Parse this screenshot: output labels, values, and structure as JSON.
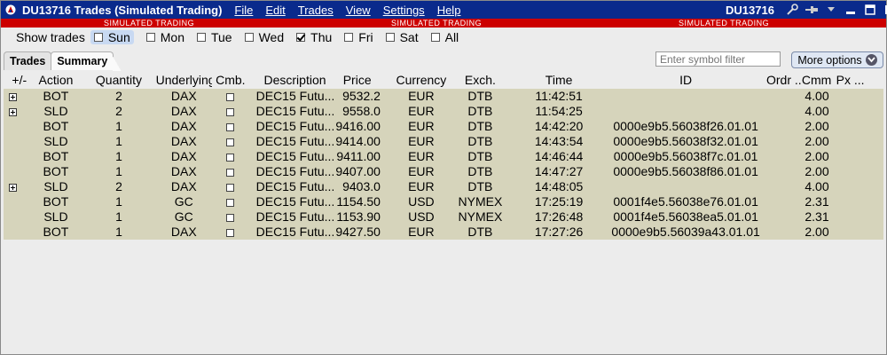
{
  "window": {
    "title": "DU13716 Trades (Simulated Trading)",
    "account": "DU13716",
    "menu": [
      "File",
      "Edit",
      "Trades",
      "View",
      "Settings",
      "Help"
    ],
    "banner_text": "SIMULATED TRADING"
  },
  "show_trades": {
    "label": "Show trades",
    "days": [
      {
        "label": "Sun",
        "checked": false,
        "active": true
      },
      {
        "label": "Mon",
        "checked": false
      },
      {
        "label": "Tue",
        "checked": false
      },
      {
        "label": "Wed",
        "checked": false
      },
      {
        "label": "Thu",
        "checked": true
      },
      {
        "label": "Fri",
        "checked": false
      },
      {
        "label": "Sat",
        "checked": false
      },
      {
        "label": "All",
        "checked": false
      }
    ]
  },
  "tabs": [
    {
      "label": "Trades",
      "active": false
    },
    {
      "label": "Summary",
      "active": true
    }
  ],
  "symbol_filter": {
    "placeholder": "Enter symbol filter",
    "value": ""
  },
  "more_options_label": "More options",
  "columns": [
    "+/-",
    "Action",
    "Quantity",
    "Underlying",
    "Cmb.",
    "Description",
    "Price",
    "Currency",
    "Exch.",
    "Time",
    "ID",
    "Ordr ...",
    "Cmm",
    "Px ..."
  ],
  "rows": [
    {
      "expand": true,
      "action": "BOT",
      "quantity": "2",
      "underlying": "DAX",
      "description": "DEC15 Futu...",
      "price": "9532.2",
      "currency": "EUR",
      "exchange": "DTB",
      "time": "11:42:51",
      "id": "",
      "commission": "4.00"
    },
    {
      "expand": true,
      "action": "SLD",
      "quantity": "2",
      "underlying": "DAX",
      "description": "DEC15 Futu...",
      "price": "9558.0",
      "currency": "EUR",
      "exchange": "DTB",
      "time": "11:54:25",
      "id": "",
      "commission": "4.00"
    },
    {
      "expand": false,
      "action": "BOT",
      "quantity": "1",
      "underlying": "DAX",
      "description": "DEC15 Futu...",
      "price": "9416.00",
      "currency": "EUR",
      "exchange": "DTB",
      "time": "14:42:20",
      "id": "0000e9b5.56038f26.01.01",
      "commission": "2.00"
    },
    {
      "expand": false,
      "action": "SLD",
      "quantity": "1",
      "underlying": "DAX",
      "description": "DEC15 Futu...",
      "price": "9414.00",
      "currency": "EUR",
      "exchange": "DTB",
      "time": "14:43:54",
      "id": "0000e9b5.56038f32.01.01",
      "commission": "2.00"
    },
    {
      "expand": false,
      "action": "BOT",
      "quantity": "1",
      "underlying": "DAX",
      "description": "DEC15 Futu...",
      "price": "9411.00",
      "currency": "EUR",
      "exchange": "DTB",
      "time": "14:46:44",
      "id": "0000e9b5.56038f7c.01.01",
      "commission": "2.00"
    },
    {
      "expand": false,
      "action": "BOT",
      "quantity": "1",
      "underlying": "DAX",
      "description": "DEC15 Futu...",
      "price": "9407.00",
      "currency": "EUR",
      "exchange": "DTB",
      "time": "14:47:27",
      "id": "0000e9b5.56038f86.01.01",
      "commission": "2.00"
    },
    {
      "expand": true,
      "action": "SLD",
      "quantity": "2",
      "underlying": "DAX",
      "description": "DEC15 Futu...",
      "price": "9403.0",
      "currency": "EUR",
      "exchange": "DTB",
      "time": "14:48:05",
      "id": "",
      "commission": "4.00"
    },
    {
      "expand": false,
      "action": "BOT",
      "quantity": "1",
      "underlying": "GC",
      "description": "DEC15 Futu...",
      "price": "1154.50",
      "currency": "USD",
      "exchange": "NYMEX",
      "time": "17:25:19",
      "id": "0001f4e5.56038e76.01.01",
      "commission": "2.31"
    },
    {
      "expand": false,
      "action": "SLD",
      "quantity": "1",
      "underlying": "GC",
      "description": "DEC15 Futu...",
      "price": "1153.90",
      "currency": "USD",
      "exchange": "NYMEX",
      "time": "17:26:48",
      "id": "0001f4e5.56038ea5.01.01",
      "commission": "2.31"
    },
    {
      "expand": false,
      "action": "BOT",
      "quantity": "1",
      "underlying": "DAX",
      "description": "DEC15 Futu...",
      "price": "9427.50",
      "currency": "EUR",
      "exchange": "DTB",
      "time": "17:27:26",
      "id": "0000e9b5.56039a43.01.01",
      "commission": "2.00"
    }
  ],
  "colors": {
    "titlebar": "#0a2a8c",
    "banner": "#cc0000",
    "row_bg": "#d6d4bb",
    "window_bg": "#ececec"
  },
  "icons": [
    "app-logo-icon",
    "wrench-icon",
    "pin-icon",
    "dropdown-icon",
    "minimize-icon",
    "maximize-icon",
    "close-icon",
    "chevron-down-icon",
    "expand-plus-icon"
  ]
}
